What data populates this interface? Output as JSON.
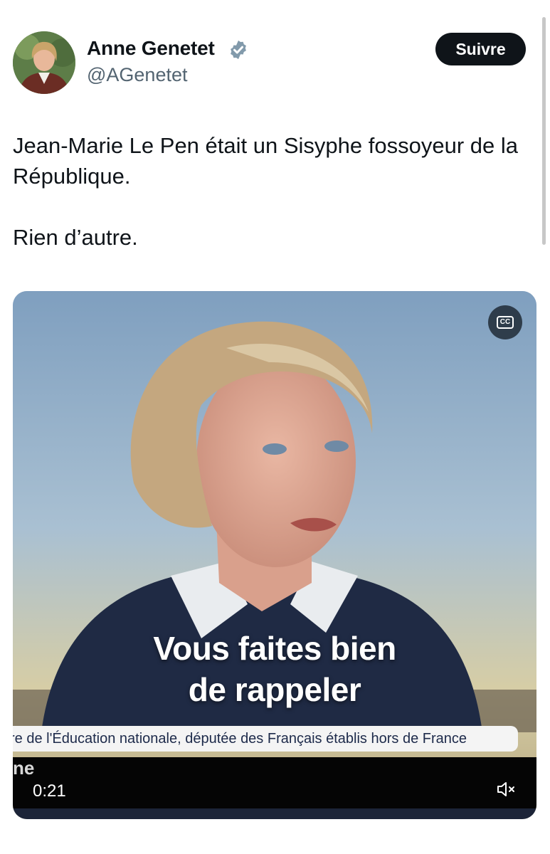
{
  "author": {
    "name": "Anne Genetet",
    "handle": "@AGenetet",
    "verified": true
  },
  "follow_button": {
    "label": "Suivre"
  },
  "tweet": {
    "paragraphs": [
      "Jean-Marie Le Pen était un Sisyphe fossoyeur de la République.",
      "Rien d’autre."
    ]
  },
  "video": {
    "caption_lines": [
      "Vous faites bien",
      "de rappeler"
    ],
    "lower_third": "re de l'Éducation nationale, députée des Français établis hors de France",
    "ticker_fragment": "ne",
    "time": "0:21",
    "cc_label": "CC"
  },
  "colors": {
    "text": "#0f1419",
    "secondary": "#536471",
    "verified": "#829aab",
    "button_bg": "#0f1419"
  },
  "icons": [
    "verified-badge-icon",
    "closed-captions-icon",
    "mute-icon"
  ]
}
